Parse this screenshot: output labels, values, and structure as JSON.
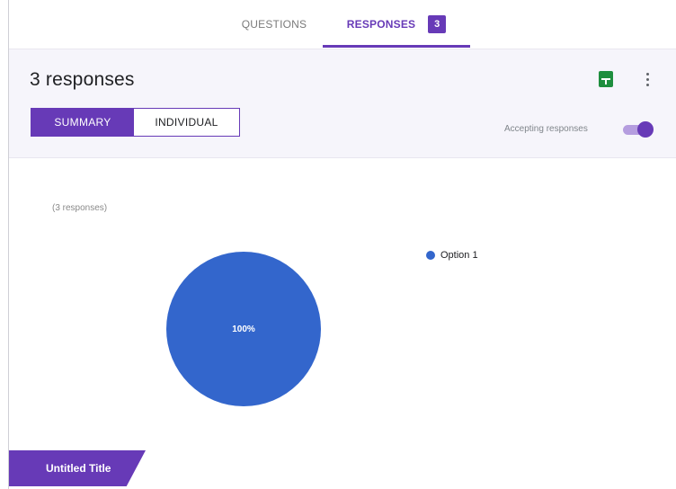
{
  "tabs": {
    "questions_label": "QUESTIONS",
    "responses_label": "RESPONSES",
    "responses_badge": "3"
  },
  "summary": {
    "title": "3 responses",
    "toggle_summary_label": "SUMMARY",
    "toggle_individual_label": "INDIVIDUAL",
    "accepting_label": "Accepting responses",
    "accepting_on": true,
    "icons": [
      "sheets-icon",
      "more-vert-icon"
    ]
  },
  "question": {
    "response_count_label": "(3 responses)"
  },
  "chart_data": {
    "type": "pie",
    "categories": [
      "Option 1"
    ],
    "values": [
      100
    ],
    "data_labels": [
      "100%"
    ],
    "colors": [
      "#3366cc"
    ],
    "legend": [
      "Option 1"
    ],
    "legend_position": "right"
  },
  "footer": {
    "title_tag": "Untitled Title"
  },
  "colors": {
    "accent": "#673ab7",
    "pie": "#3366cc",
    "sheets": "#1e8e3e"
  }
}
